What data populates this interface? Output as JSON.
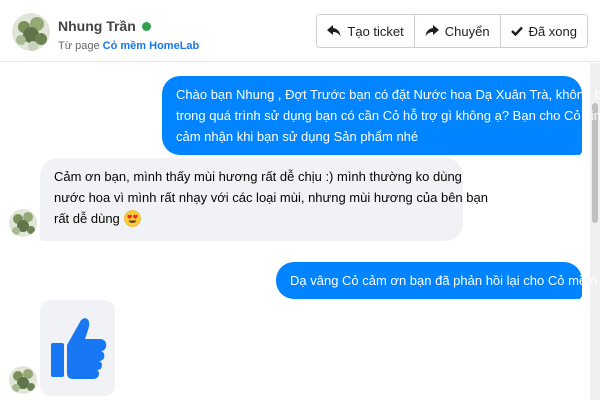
{
  "contact": {
    "name": "Nhung Trần",
    "status_color": "#31a24c",
    "source_prefix": "Từ page ",
    "source_page": "Cỏ mềm HomeLab"
  },
  "actions": [
    {
      "label": "Tạo ticket",
      "icon": "reply-icon"
    },
    {
      "label": "Chuyển",
      "icon": "forward-icon"
    },
    {
      "label": "Đã xong",
      "icon": "check-icon"
    }
  ],
  "colors": {
    "outgoing_bubble": "#0084ff",
    "incoming_bubble": "#f0f2f5",
    "brand_link": "#1877f2",
    "like_icon": "#1877f2"
  },
  "messages": [
    {
      "direction": "outgoing",
      "lines": [
        "Chào bạn Nhung , Đợt Trước bạn có đặt Nước hoa Dạ Xuân Trà, không biết",
        "trong quá trình sử dụng bạn có cần Cỏ hỗ trợ gì không ạ? Bạn cho Cỏ xin",
        "cảm nhận khi bạn sử dụng Sản phẩm nhé"
      ]
    },
    {
      "direction": "incoming",
      "lines": [
        "Cảm ơn bạn, mình thấy mùi hương rất dễ chịu :) mình thường ko dùng",
        "nước hoa vì mình rất nhạy với các loại mùi, nhưng mùi hương của bên bạn",
        "rất dễ dùng"
      ],
      "emoji": "heart-eyes-emoji"
    },
    {
      "direction": "outgoing",
      "lines": [
        "Dạ vâng Cỏ cảm ơn bạn đã phản hồi lại cho Cỏ mềm ạ."
      ]
    },
    {
      "direction": "incoming",
      "sticker": "thumbs-up-icon"
    }
  ]
}
